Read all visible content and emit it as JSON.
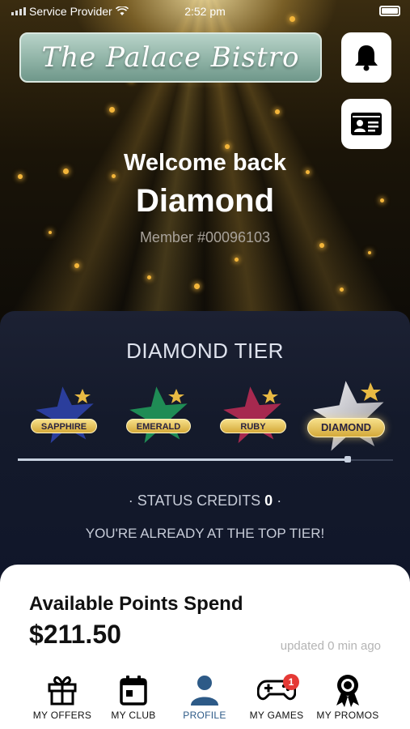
{
  "status_bar": {
    "carrier": "Service Provider",
    "time": "2:52 pm"
  },
  "header": {
    "logo_text": "The Palace Bistro"
  },
  "welcome": {
    "greeting": "Welcome back",
    "name": "Diamond",
    "member_number": "Member #00096103"
  },
  "tier": {
    "title": "DIAMOND TIER",
    "levels": [
      {
        "label": "SAPPHIRE",
        "color": "#2a3f9a"
      },
      {
        "label": "EMERALD",
        "color": "#1f8a55"
      },
      {
        "label": "RUBY",
        "color": "#a3294d"
      },
      {
        "label": "DIAMOND",
        "color": "#c9c9cf"
      }
    ],
    "progress": 0.88,
    "status_credits_label": "· STATUS CREDITS",
    "status_credits_value": "0",
    "status_credits_suffix": "·",
    "message": "YOU'RE ALREADY AT THE TOP TIER!"
  },
  "points": {
    "label": "Available Points Spend",
    "value": "$211.50",
    "updated": "updated 0 min ago"
  },
  "nav": {
    "items": [
      {
        "label": "MY OFFERS",
        "icon": "gift-icon"
      },
      {
        "label": "MY CLUB",
        "icon": "calendar-icon"
      },
      {
        "label": "PROFILE",
        "icon": "person-icon"
      },
      {
        "label": "MY GAMES",
        "icon": "gamepad-icon",
        "badge": "1"
      },
      {
        "label": "MY PROMOS",
        "icon": "award-icon"
      }
    ],
    "active_color": "#2d5a87"
  }
}
